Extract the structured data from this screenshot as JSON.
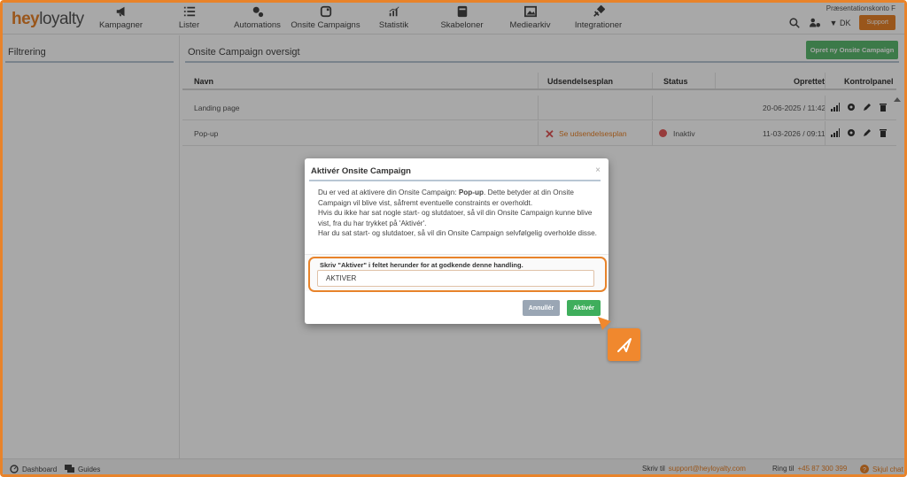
{
  "brand": {
    "logo_part1": "hey",
    "logo_part2": "loyalty",
    "accent": "#e8832a"
  },
  "header": {
    "nav": [
      {
        "label": "Kampagner",
        "icon": "megaphone-icon"
      },
      {
        "label": "Lister",
        "icon": "list-icon"
      },
      {
        "label": "Automations",
        "icon": "automation-icon"
      },
      {
        "label": "Onsite Campaigns",
        "icon": "onsite-icon"
      },
      {
        "label": "Statistik",
        "icon": "chart-icon"
      },
      {
        "label": "Skabeloner",
        "icon": "template-icon"
      },
      {
        "label": "Mediearkiv",
        "icon": "image-icon"
      },
      {
        "label": "Integrationer",
        "icon": "plug-icon"
      }
    ],
    "account": "Præsentationskonto F",
    "language": "DK",
    "support_label": "Support"
  },
  "sidebar": {
    "title": "Filtrering"
  },
  "main": {
    "title": "Onsite Campaign oversigt",
    "create_label": "Opret ny Onsite Campaign",
    "columns": {
      "name": "Navn",
      "schedule": "Udsendelsesplan",
      "status": "Status",
      "created": "Oprettet",
      "control": "Kontrolpanel"
    },
    "rows": [
      {
        "name": "Landing page",
        "schedule": "",
        "status": "",
        "created": "20-06-2025 / 11:42"
      },
      {
        "name": "Pop-up",
        "schedule": "Se udsendelsesplan",
        "status": "Inaktiv",
        "created": "11-03-2026 / 09:11"
      }
    ]
  },
  "modal": {
    "title": "Aktivér Onsite Campaign",
    "close": "×",
    "body_pre": "Du er ved at aktivere din Onsite Campaign: ",
    "body_campaign": "Pop-up",
    "body_post": ". Dette betyder at din Onsite Campaign vil blive vist, såfremt eventuelle constraints er overholdt.",
    "body_line2": "Hvis du ikke har sat nogle start- og slutdatoer, så vil din Onsite Campaign kunne blive vist, fra du har trykket på 'Aktivér'.",
    "body_line3": "Har du sat start- og slutdatoer, så vil din Onsite Campaign selvfølgelig overholde disse.",
    "confirm_label": "Skriv \"Aktiver\" i feltet herunder for at godkende denne handling.",
    "confirm_value": "AKTIVER",
    "cancel_label": "Annullér",
    "activate_label": "Aktivér"
  },
  "footer": {
    "dashboard": "Dashboard",
    "guides": "Guides",
    "write_to": "Skriv til",
    "email": "support@heyloyalty.com",
    "call": "Ring til",
    "phone": "+45 87 300 399",
    "hide_chat": "Skjul chat"
  }
}
